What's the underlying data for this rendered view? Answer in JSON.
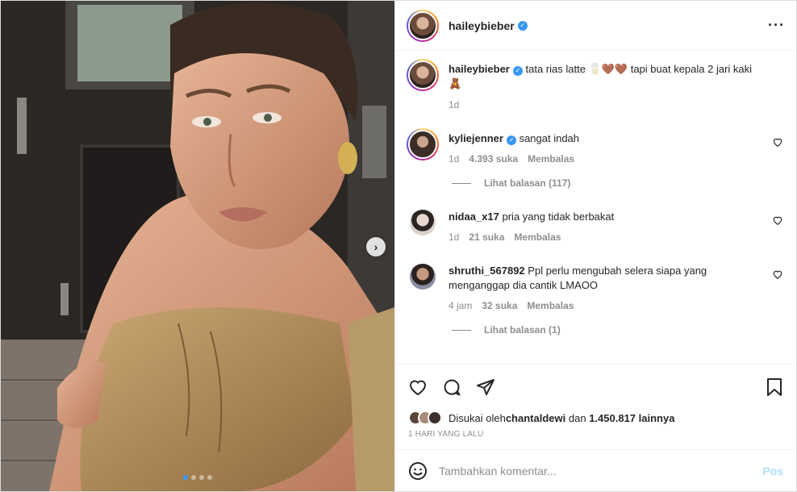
{
  "post": {
    "username": "haileybieber",
    "more_icon": "more-horizontal-icon"
  },
  "caption": {
    "username": "haileybieber",
    "text": "tata rias latte 🥛🤎🤎 tapi buat kepala 2 jari kaki 🧸",
    "time": "1d"
  },
  "comments": [
    {
      "username": "kyliejenner",
      "verified": true,
      "text": "sangat indah",
      "time": "1d",
      "likes": "4.393 suka",
      "reply": "Membalas",
      "replies_label": "Lihat balasan (117)"
    },
    {
      "username": "nidaa_x17",
      "verified": false,
      "text": "pria yang tidak berbakat",
      "time": "1d",
      "likes": "21 suka",
      "reply": "Membalas"
    },
    {
      "username": "shruthi_567892",
      "verified": false,
      "text": "Ppl perlu mengubah selera siapa yang menganggap dia cantik LMAOO",
      "time": "4 jam",
      "likes": "32 suka",
      "reply": "Membalas",
      "replies_label": "Lihat balasan (1)"
    }
  ],
  "likes": {
    "prefix": "Disukai oleh",
    "user": "chantaldewi",
    "middle": "dan",
    "count": "1.450.817 lainnya"
  },
  "timestamp": "1 HARI YANG LALU",
  "add_comment": {
    "placeholder": "Tambahkan komentar...",
    "post_label": "Pos"
  },
  "carousel": {
    "slides": 4,
    "active": 1
  },
  "colors": {
    "accent": "#3897f0",
    "post_disabled": "#b2dffc",
    "muted": "#8e8e8e"
  }
}
